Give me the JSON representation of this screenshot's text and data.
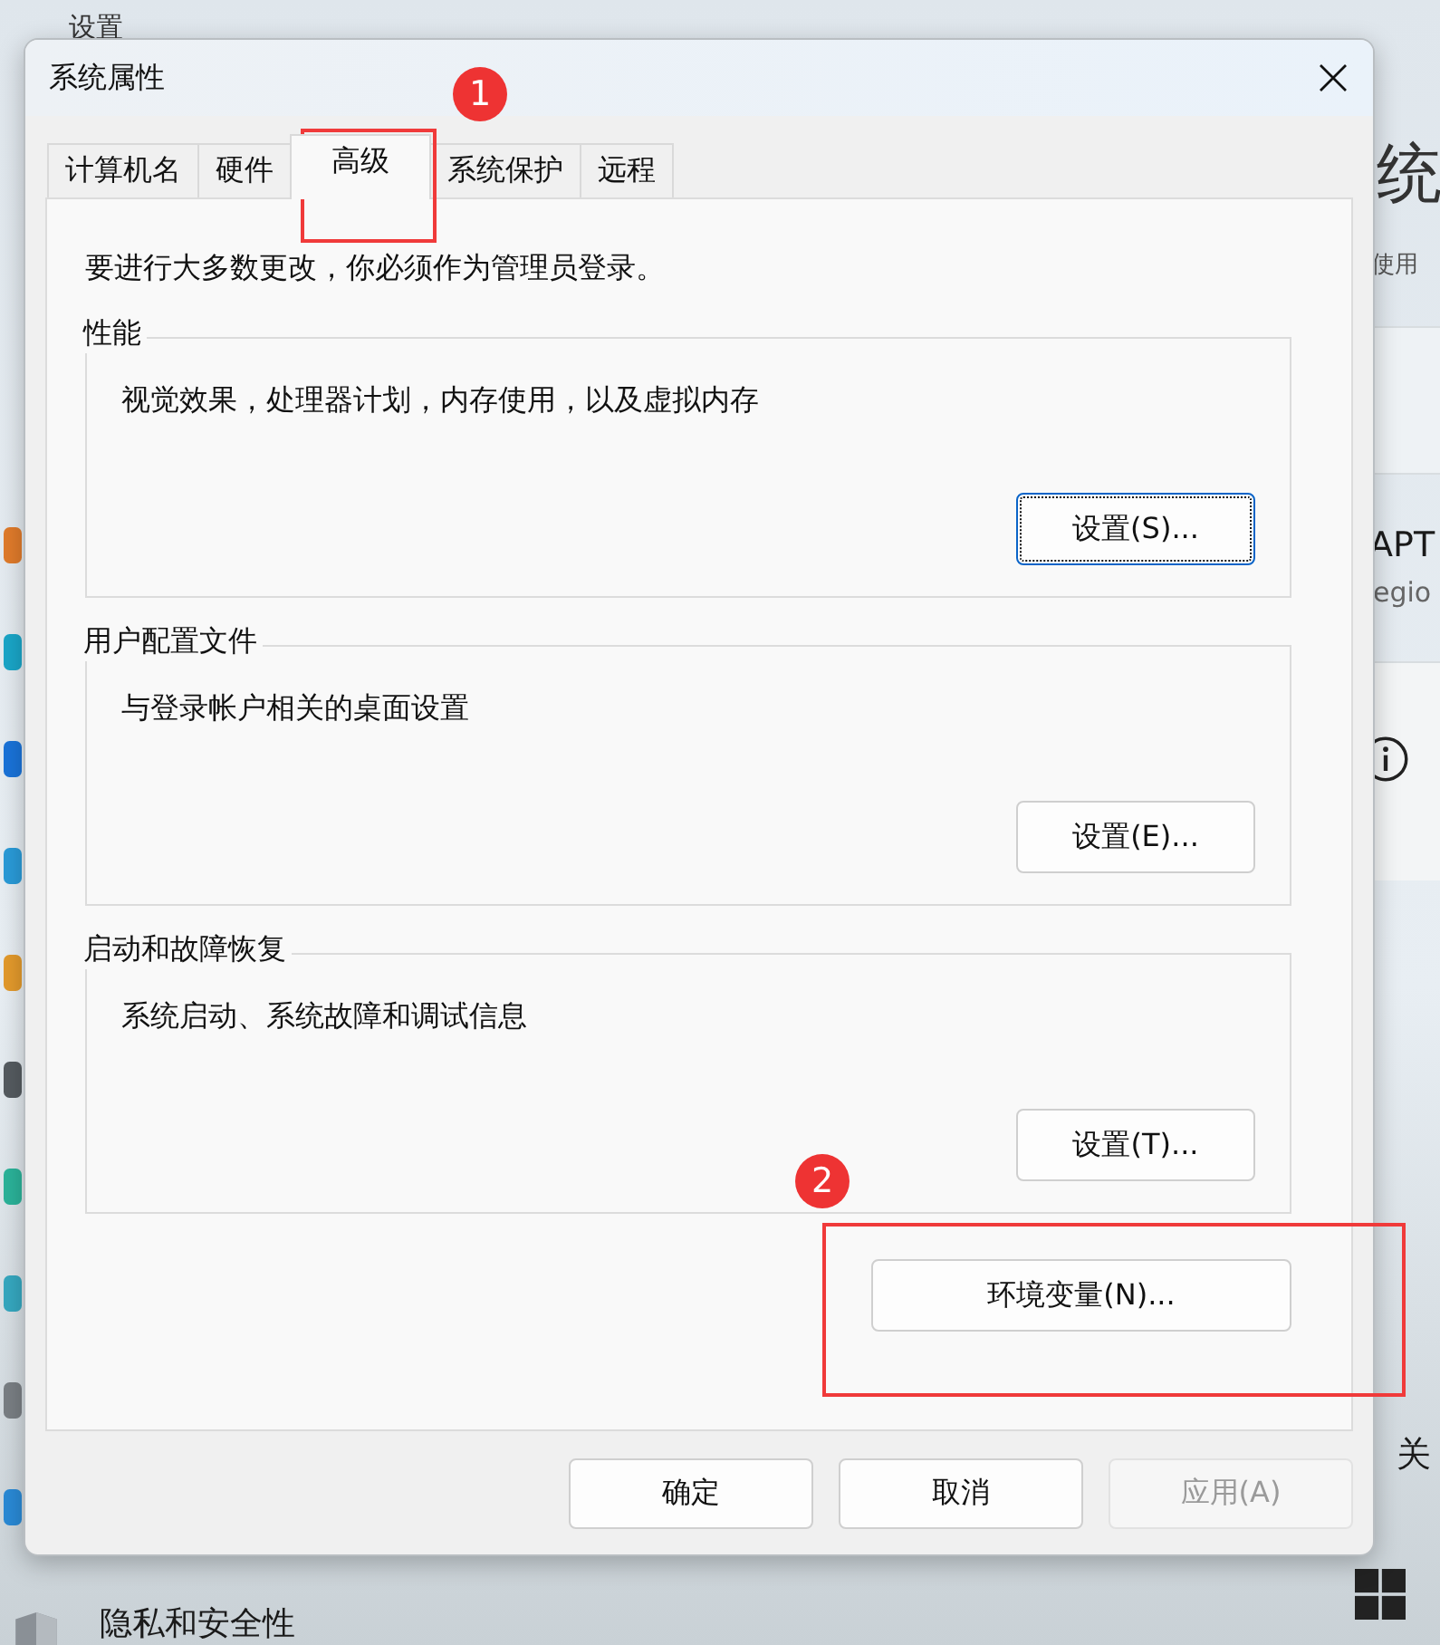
{
  "background_window": {
    "title": "设置",
    "heading": "统",
    "subtitle": "使用",
    "device_name": "APT",
    "device_detail": "egio",
    "related_link": "关",
    "nav_item": "隐私和安全性"
  },
  "dialog": {
    "title": "系统属性",
    "tabs": [
      {
        "label": "计算机名",
        "selected": false
      },
      {
        "label": "硬件",
        "selected": false
      },
      {
        "label": "高级",
        "selected": true
      },
      {
        "label": "系统保护",
        "selected": false
      },
      {
        "label": "远程",
        "selected": false
      }
    ],
    "notice": "要进行大多数更改，你必须作为管理员登录。",
    "groups": [
      {
        "title": "性能",
        "description": "视觉效果，处理器计划，内存使用，以及虚拟内存",
        "button": "设置(S)...",
        "focused": true
      },
      {
        "title": "用户配置文件",
        "description": "与登录帐户相关的桌面设置",
        "button": "设置(E)...",
        "focused": false
      },
      {
        "title": "启动和故障恢复",
        "description": "系统启动、系统故障和调试信息",
        "button": "设置(T)...",
        "focused": false
      }
    ],
    "env_button": "环境变量(N)...",
    "buttons": [
      {
        "label": "确定",
        "disabled": false
      },
      {
        "label": "取消",
        "disabled": false
      },
      {
        "label": "应用(A)",
        "disabled": true
      }
    ]
  },
  "annotations": [
    {
      "number": "1"
    },
    {
      "number": "2"
    }
  ]
}
